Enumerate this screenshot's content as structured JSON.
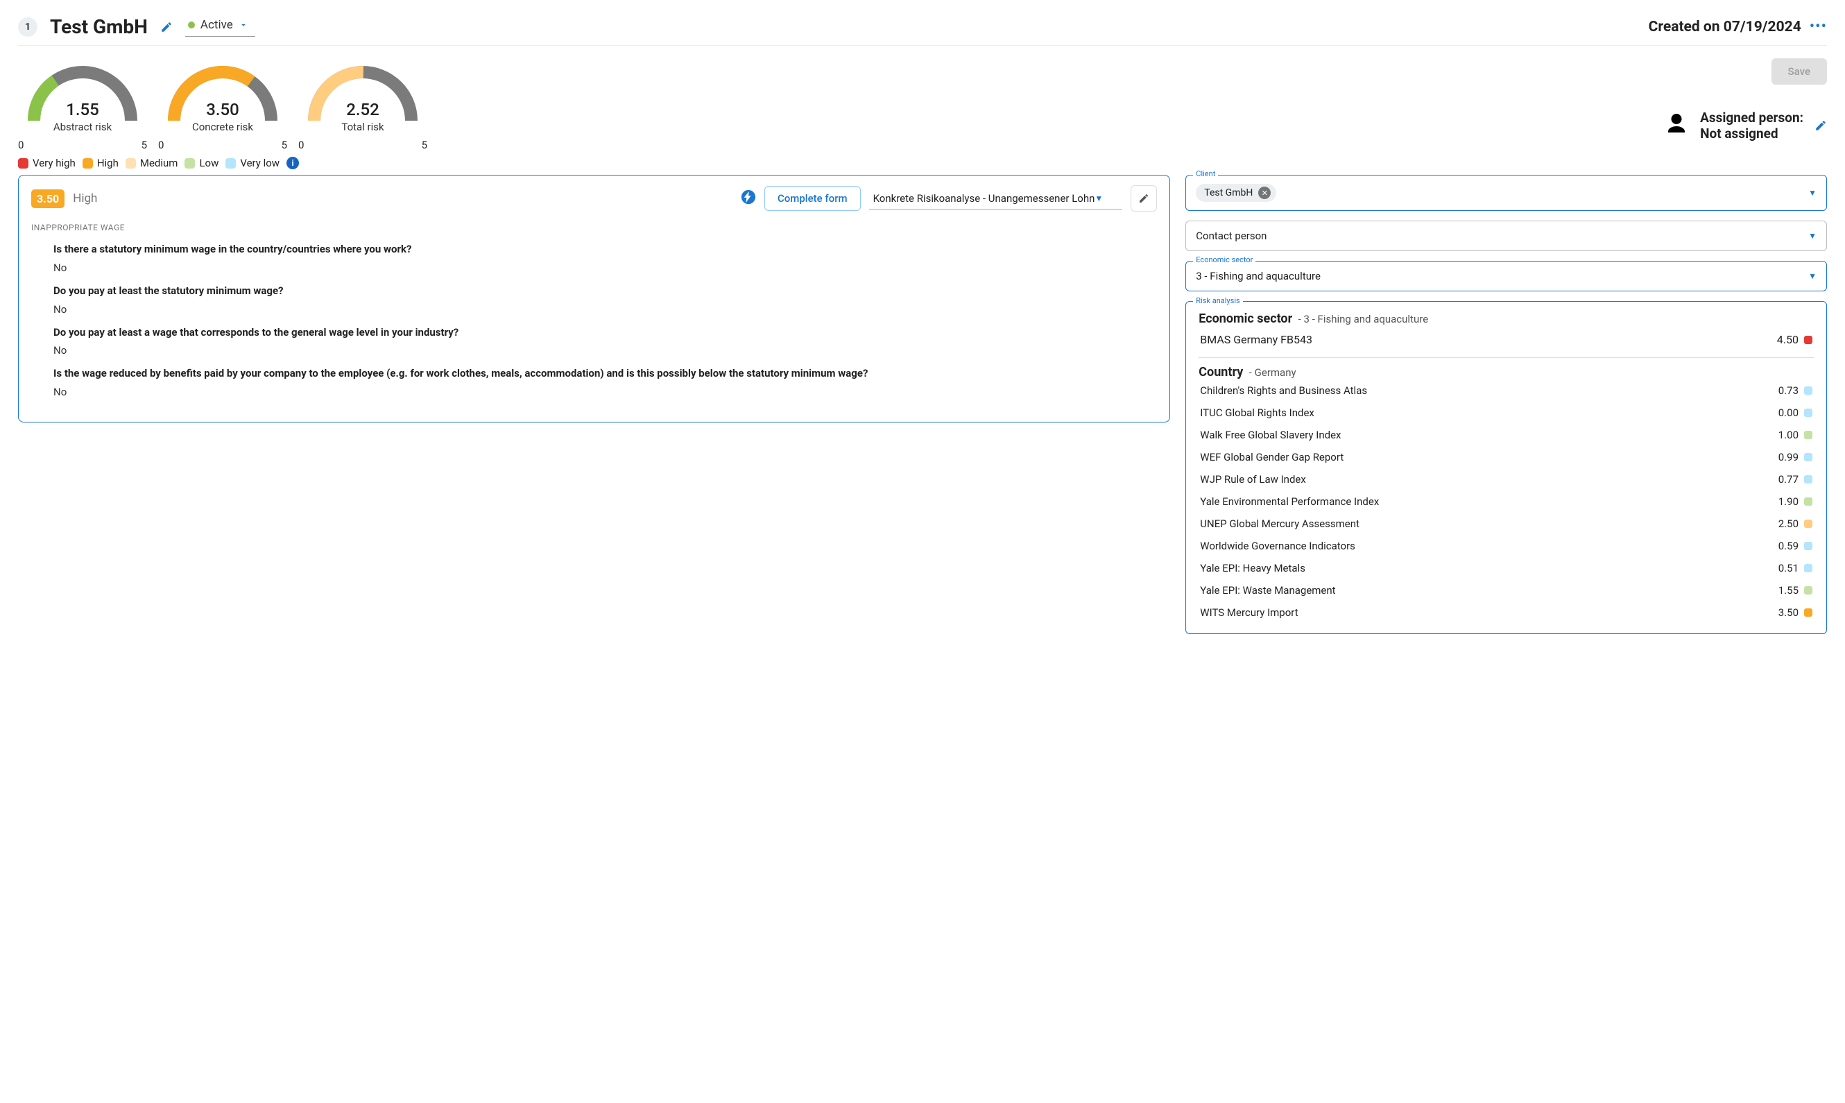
{
  "header": {
    "id_badge": "1",
    "company_name": "Test GmbH",
    "status_label": "Active",
    "status_color": "#4caf50",
    "created_label": "Created on 07/19/2024"
  },
  "gauges": [
    {
      "value": "1.55",
      "label": "Abstract risk",
      "min": "0",
      "max": "5",
      "fill_fraction": 0.31,
      "color": "#8bc34a"
    },
    {
      "value": "3.50",
      "label": "Concrete risk",
      "min": "0",
      "max": "5",
      "fill_fraction": 0.7,
      "color": "#f9a825"
    },
    {
      "value": "2.52",
      "label": "Total risk",
      "min": "0",
      "max": "5",
      "fill_fraction": 0.504,
      "color": "#ffcc80"
    }
  ],
  "risk_legend": [
    {
      "label": "Very high",
      "color": "#e53935"
    },
    {
      "label": "High",
      "color": "#f9a825"
    },
    {
      "label": "Medium",
      "color": "#ffe0b2"
    },
    {
      "label": "Low",
      "color": "#c5e1a5"
    },
    {
      "label": "Very low",
      "color": "#b3e5fc"
    }
  ],
  "save_button": "Save",
  "assigned": {
    "heading": "Assigned person:",
    "value": "Not assigned"
  },
  "form_card": {
    "score": "3.50",
    "score_level": "High",
    "complete_button": "Complete form",
    "form_select": "Konkrete Risikoanalyse - Unangemessener Lohn",
    "section_caption": "INAPPROPRIATE WAGE",
    "questions": [
      {
        "q": "Is there a statutory minimum wage in the country/countries where you work?",
        "a": "No"
      },
      {
        "q": "Do you pay at least the statutory minimum wage?",
        "a": "No"
      },
      {
        "q": "Do you pay at least a wage that corresponds to the general wage level in your industry?",
        "a": "No"
      },
      {
        "q": "Is the wage reduced by benefits paid by your company to the employee (e.g. for work clothes, meals, accommodation) and is this possibly below the statutory minimum wage?",
        "a": "No"
      }
    ]
  },
  "right_panel": {
    "client": {
      "label": "Client",
      "chip": "Test GmbH"
    },
    "contact": {
      "label": "Contact person",
      "value": "Contact person"
    },
    "sector": {
      "label": "Economic sector",
      "value": "3 - Fishing and aquaculture"
    }
  },
  "risk_analysis": {
    "box_label": "Risk analysis",
    "sector_heading": "Economic sector",
    "sector_sub": "- 3 - Fishing and aquaculture",
    "sector_items": [
      {
        "name": "BMAS Germany FB543",
        "score": "4.50",
        "color": "#e53935"
      }
    ],
    "country_heading": "Country",
    "country_sub": "- Germany",
    "country_items": [
      {
        "name": "Children's Rights and Business Atlas",
        "score": "0.73",
        "color": "#b3e5fc"
      },
      {
        "name": "ITUC Global Rights Index",
        "score": "0.00",
        "color": "#b3e5fc"
      },
      {
        "name": "Walk Free Global Slavery Index",
        "score": "1.00",
        "color": "#c5e1a5"
      },
      {
        "name": "WEF Global Gender Gap Report",
        "score": "0.99",
        "color": "#b3e5fc"
      },
      {
        "name": "WJP Rule of Law Index",
        "score": "0.77",
        "color": "#b3e5fc"
      },
      {
        "name": "Yale Environmental Performance Index",
        "score": "1.90",
        "color": "#c5e1a5"
      },
      {
        "name": "UNEP Global Mercury Assessment",
        "score": "2.50",
        "color": "#ffcc80"
      },
      {
        "name": "Worldwide Governance Indicators",
        "score": "0.59",
        "color": "#b3e5fc"
      },
      {
        "name": "Yale EPI: Heavy Metals",
        "score": "0.51",
        "color": "#b3e5fc"
      },
      {
        "name": "Yale EPI: Waste Management",
        "score": "1.55",
        "color": "#c5e1a5"
      },
      {
        "name": "WITS Mercury Import",
        "score": "3.50",
        "color": "#f9a825"
      }
    ]
  },
  "chart_data": [
    {
      "type": "gauge",
      "title": "Abstract risk",
      "range": [
        0,
        5
      ],
      "value": 1.55
    },
    {
      "type": "gauge",
      "title": "Concrete risk",
      "range": [
        0,
        5
      ],
      "value": 3.5
    },
    {
      "type": "gauge",
      "title": "Total risk",
      "range": [
        0,
        5
      ],
      "value": 2.52
    }
  ]
}
